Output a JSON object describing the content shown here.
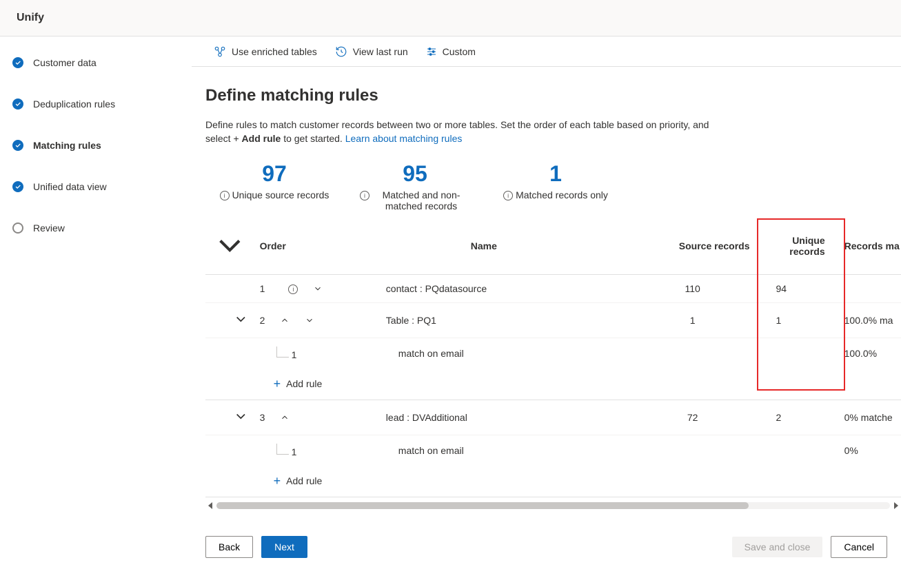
{
  "header": {
    "title": "Unify"
  },
  "sidebar": {
    "steps": [
      {
        "label": "Customer data",
        "state": "done"
      },
      {
        "label": "Deduplication rules",
        "state": "done"
      },
      {
        "label": "Matching rules",
        "state": "done",
        "active": true
      },
      {
        "label": "Unified data view",
        "state": "done"
      },
      {
        "label": "Review",
        "state": "pending"
      }
    ]
  },
  "toolbar": {
    "enriched": "Use enriched tables",
    "lastrun": "View last run",
    "custom": "Custom"
  },
  "page": {
    "title": "Define matching rules",
    "desc_pre": "Define rules to match customer records between two or more tables. Set the order of each table based on priority, and select + ",
    "desc_bold": "Add rule",
    "desc_post": " to get started. ",
    "learn_link": "Learn about matching rules"
  },
  "stats": [
    {
      "value": "97",
      "label": "Unique source records"
    },
    {
      "value": "95",
      "label": "Matched and non-matched records"
    },
    {
      "value": "1",
      "label": "Matched records only"
    }
  ],
  "table": {
    "headers": {
      "order": "Order",
      "name": "Name",
      "source": "Source records",
      "unique": "Unique records",
      "matched": "Records ma"
    },
    "rows": [
      {
        "order": "1",
        "name": "contact : PQdatasource",
        "source": "110",
        "unique": "94",
        "matched": "",
        "hasInfo": true,
        "hasChevUp": false
      },
      {
        "order": "2",
        "name": "Table : PQ1",
        "source": "1",
        "unique": "1",
        "matched": "100.0% ma",
        "hasExpand": true,
        "hasChevUp": true
      },
      {
        "sub": true,
        "idx": "1",
        "name": "match on email",
        "matched": "100.0%"
      },
      {
        "addRule": true,
        "label": "Add rule"
      },
      {
        "order": "3",
        "name": "lead : DVAdditional",
        "source": "72",
        "unique": "2",
        "matched": "0% matche",
        "hasExpand": true,
        "hasChevUp": true,
        "noDown": true
      },
      {
        "sub": true,
        "idx": "1",
        "name": "match on email",
        "matched": "0%"
      },
      {
        "addRule": true,
        "label": "Add rule"
      }
    ]
  },
  "footer": {
    "back": "Back",
    "next": "Next",
    "save": "Save and close",
    "cancel": "Cancel"
  }
}
